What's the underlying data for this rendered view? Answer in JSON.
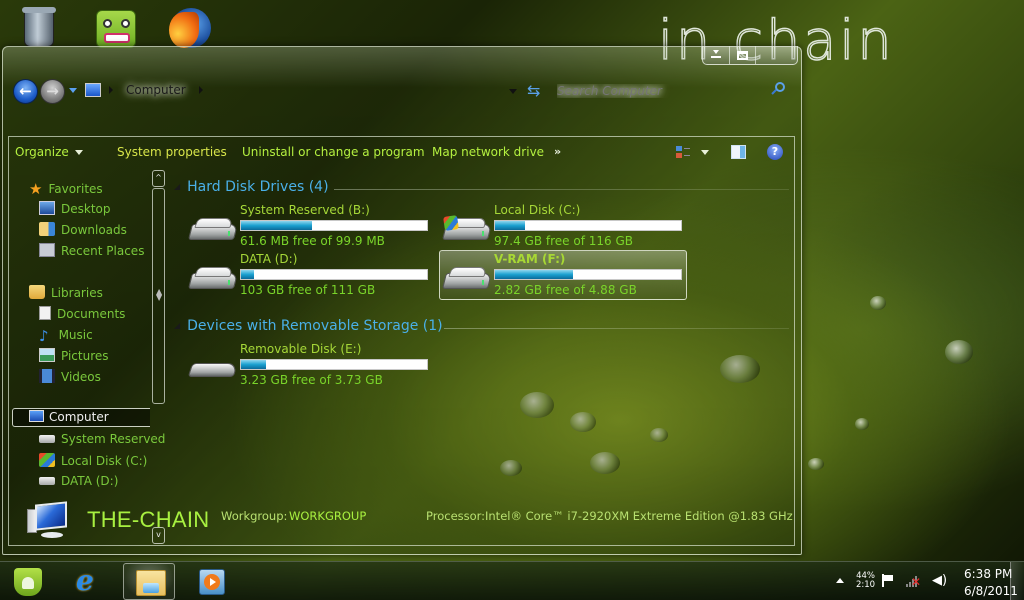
{
  "desktop": {
    "brand_text": "in chain",
    "icons": [
      {
        "name": "Recycle Bin",
        "icon": "recycle-bin-icon"
      },
      {
        "name": "Monster app",
        "icon": "monster-icon"
      },
      {
        "name": "Mozilla Firefox",
        "icon": "firefox-icon"
      }
    ]
  },
  "window": {
    "caption_buttons": [
      "minimize",
      "maximize",
      "close"
    ],
    "address_bar": {
      "back_glyph": "←",
      "forward_glyph": "→",
      "breadcrumb": [
        "Computer"
      ],
      "refresh_glyph": "⇆"
    },
    "search": {
      "placeholder": "Search Computer",
      "value": ""
    },
    "toolbar": {
      "organize": "Organize",
      "system_properties": "System properties",
      "uninstall": "Uninstall or change a program",
      "map_network_drive": "Map network drive",
      "more": "»",
      "help_glyph": "?"
    },
    "nav_pane": {
      "favorites": {
        "label": "Favorites",
        "items": [
          "Desktop",
          "Downloads",
          "Recent Places"
        ]
      },
      "libraries": {
        "label": "Libraries",
        "items": [
          "Documents",
          "Music",
          "Pictures",
          "Videos"
        ]
      },
      "computer": {
        "label": "Computer",
        "items": [
          "System Reserved",
          "Local Disk (C:)",
          "DATA (D:)"
        ]
      },
      "scroll_up_glyph": "^",
      "scroll_down_glyph": "v"
    },
    "content": {
      "groups": [
        {
          "title": "Hard Disk Drives (4)",
          "drives": [
            {
              "name": "System Reserved (B:)",
              "free": "61.6 MB free of 99.9 MB",
              "used_fraction": 0.383,
              "icon": "hard-drive-icon"
            },
            {
              "name": "Local Disk (C:)",
              "free": "97.4 GB free of 116 GB",
              "used_fraction": 0.16,
              "icon": "windows-drive-icon"
            },
            {
              "name": "DATA (D:)",
              "free": "103 GB free of 111 GB",
              "used_fraction": 0.072,
              "icon": "hard-drive-icon"
            },
            {
              "name": "V-RAM (F:)",
              "free": "2.82 GB free of 4.88 GB",
              "used_fraction": 0.422,
              "icon": "hard-drive-icon",
              "selected": true
            }
          ]
        },
        {
          "title": "Devices with Removable Storage (1)",
          "drives": [
            {
              "name": "Removable Disk (E:)",
              "free": "3.23 GB free of 3.73 GB",
              "used_fraction": 0.134,
              "icon": "removable-disk-icon"
            }
          ]
        }
      ]
    },
    "details": {
      "computer_name": "THE-CHAIN",
      "workgroup_label": "Workgroup:",
      "workgroup_value": "WORKGROUP",
      "processor_label": "Processor:",
      "processor_value": "Intel® Core™ i7-2920XM Extreme Edition  @1.83 GHz"
    }
  },
  "taskbar": {
    "apps": [
      {
        "name": "Android",
        "icon": "android-icon"
      },
      {
        "name": "Internet Explorer",
        "icon": "ie-icon",
        "glyph": "e"
      },
      {
        "name": "Windows Explorer",
        "icon": "folder-icon",
        "active": true
      },
      {
        "name": "Windows Media Player",
        "icon": "media-player-icon"
      }
    ],
    "tray": {
      "battery_percent": "44%",
      "battery_time": "2:10",
      "volume_glyph": "◀)",
      "network_status_glyph": "✕",
      "time": "6:38 PM",
      "date": "6/8/2011"
    }
  }
}
